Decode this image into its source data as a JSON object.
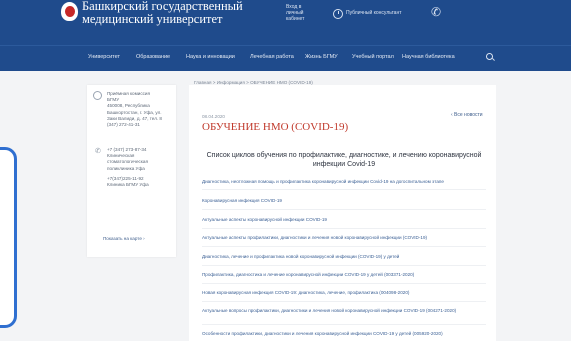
{
  "header": {
    "university_name": "Башкирский государственный медицинский университет",
    "cabinet_label": "Вход в личный кабинет",
    "consultant_label": "Публичный консультант",
    "phone_icon": "phone-icon",
    "background_color": "#1f4b8c"
  },
  "nav": {
    "items": [
      "Университет",
      "Образование",
      "Наука и инновации",
      "Лечебная работа",
      "Жизнь БГМУ",
      "Учебный портал",
      "Научная библиотека"
    ],
    "search_icon": "search-icon"
  },
  "breadcrumb": "Главная  >  Информация  >  ОБУЧЕНИЕ НМО (COVID-19)",
  "sidebar": {
    "address_lines": [
      "Приёмная комиссия",
      "БГМУ",
      "450008, Республика",
      "Башкортостан, г. Уфа, ул.",
      "Заки Валиди, д. 47, тел. 8",
      "(347) 272-41-31"
    ],
    "phone_lines": [
      "+7 (347) 273-87-34",
      "Клиническая",
      "стоматологическая",
      "поликлиника Уфа",
      "",
      "+7(347)225-11-92",
      "Клиника БГМУ Уфа"
    ],
    "map_link": "Показать на карте  ›"
  },
  "article": {
    "date": "08.04.2020",
    "all_news": "‹  Все новости",
    "title": "ОБУЧЕНИЕ НМО (COVID-19)",
    "heading": "Список циклов обучения по профилактике, диагностике, и лечению коронавирусной инфекции Covid-19",
    "title_color": "#c0392b",
    "link_color": "#3a5f94",
    "courses": [
      "Диагностика, неотложная помощь и профилактика коронавирусной инфекции Covid-19 на догоспитальном этапе",
      "Коронавирусная инфекция COVID-19",
      "Актуальные аспекты коронавирусной инфекции COVID-19",
      "Актуальные аспекты профилактики, диагностики и лечения новой коронавирусной инфекции (COVID-19)",
      "Диагностика, лечение и профилактика новой коронавирусной инфекции (COVID-19) у детей",
      "Профилактика, диагностика и лечение коронавирусной инфекции COVID-19 у детей (003371-2020)",
      "Новая коронавирусная инфекция COVID-19: диагностика, лечение, профилактика (004098-2020)",
      "Актуальные вопросы профилактики, диагностики и лечения новой коронавирусной инфекции COVID-19 (004271-2020)",
      "Особенности профилактики, диагностики и лечения коронавирусной инфекции COVID-19 у детей (005920-2020)"
    ]
  }
}
